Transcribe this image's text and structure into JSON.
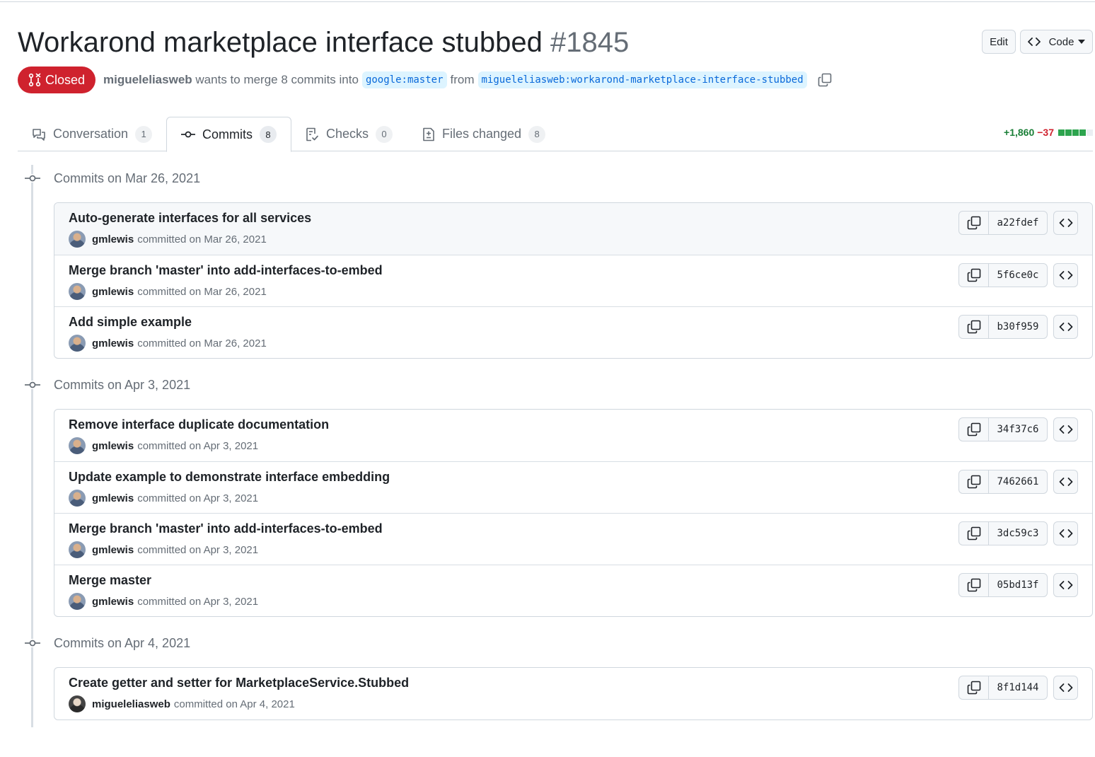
{
  "pr": {
    "title": "Workarond marketplace interface stubbed",
    "number": "#1845",
    "state": "Closed",
    "author": "migueleliasweb",
    "merge_text": "wants to merge 8 commits into",
    "base_branch": "google:master",
    "from_text": "from",
    "head_branch": "migueleliasweb:workarond-marketplace-interface-stubbed"
  },
  "header_actions": {
    "edit_label": "Edit",
    "code_label": "Code"
  },
  "tabs": [
    {
      "label": "Conversation",
      "count": "1",
      "icon": "comment-discussion-icon"
    },
    {
      "label": "Commits",
      "count": "8",
      "icon": "git-commit-icon",
      "active": true
    },
    {
      "label": "Checks",
      "count": "0",
      "icon": "checklist-icon"
    },
    {
      "label": "Files changed",
      "count": "8",
      "icon": "file-diff-icon"
    }
  ],
  "diffstat": {
    "additions": "+1,860",
    "deletions": "−37",
    "colors": {
      "add": "#1a7f37",
      "del": "#cf222e"
    }
  },
  "commit_groups": [
    {
      "label": "Commits on Mar 26, 2021",
      "commits": [
        {
          "message": "Auto-generate interfaces for all services",
          "author": "gmlewis",
          "action": "committed on Mar 26, 2021",
          "sha": "a22fdef"
        },
        {
          "message": "Merge branch 'master' into add-interfaces-to-embed",
          "author": "gmlewis",
          "action": "committed on Mar 26, 2021",
          "sha": "5f6ce0c"
        },
        {
          "message": "Add simple example",
          "author": "gmlewis",
          "action": "committed on Mar 26, 2021",
          "sha": "b30f959"
        }
      ]
    },
    {
      "label": "Commits on Apr 3, 2021",
      "commits": [
        {
          "message": "Remove interface duplicate documentation",
          "author": "gmlewis",
          "action": "committed on Apr 3, 2021",
          "sha": "34f37c6"
        },
        {
          "message": "Update example to demonstrate interface embedding",
          "author": "gmlewis",
          "action": "committed on Apr 3, 2021",
          "sha": "7462661"
        },
        {
          "message": "Merge branch 'master' into add-interfaces-to-embed",
          "author": "gmlewis",
          "action": "committed on Apr 3, 2021",
          "sha": "3dc59c3"
        },
        {
          "message": "Merge master",
          "author": "gmlewis",
          "action": "committed on Apr 3, 2021",
          "sha": "05bd13f"
        }
      ]
    },
    {
      "label": "Commits on Apr 4, 2021",
      "commits": [
        {
          "message": "Create getter and setter for MarketplaceService.Stubbed",
          "author": "migueleliasweb",
          "action": "committed on Apr 4, 2021",
          "sha": "8f1d144"
        }
      ]
    }
  ]
}
